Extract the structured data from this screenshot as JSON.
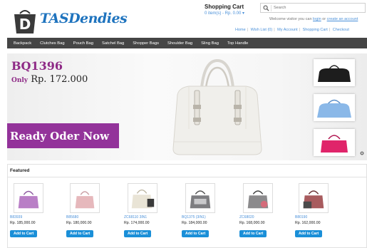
{
  "header": {
    "logo_text": "TASDendies",
    "logo_letter": "D",
    "cart_title": "Shopping Cart",
    "cart_summary": "0 item(s) - Rp. 0.00",
    "search_placeholder": "Search",
    "welcome_prefix": "Welcome visitor you can",
    "login_link": "login",
    "or_text": "or",
    "create_account_link": "create an account",
    "top_links": [
      "Home",
      "Wish List (0)",
      "My Account",
      "Shopping Cart",
      "Checkout"
    ]
  },
  "nav": {
    "items": [
      "Backpack",
      "Clutches Bag",
      "Pouch Bag",
      "Satchel Bag",
      "Shopper Bags",
      "Shoulder Bag",
      "Sling Bag",
      "Top Handle"
    ]
  },
  "banner": {
    "product_code": "BQ1396",
    "only_label": "Only",
    "price": "Rp. 172.000",
    "cta": "Ready Oder Now"
  },
  "featured": {
    "title": "Featured",
    "add_to_cart_label": "Add to Cart",
    "products": [
      {
        "code": "B83939",
        "price": "Rp. 185,000.00",
        "color": "#b97fc6"
      },
      {
        "code": "B85680",
        "price": "Rp. 180,000.00",
        "color": "#e6b8bc"
      },
      {
        "code": "ZC68110 3IN1",
        "price": "Rp. 174,000.00",
        "color": "#e9e4d6"
      },
      {
        "code": "BQ1375 (3IN1)",
        "price": "Rp. 184,000.00",
        "color": "#7d7d80"
      },
      {
        "code": "ZC68020",
        "price": "Rp. 168,000.00",
        "color": "#8b8a8c"
      },
      {
        "code": "B80190",
        "price": "Rp. 162,000.00",
        "color": "#a85b5e"
      }
    ]
  },
  "colors": {
    "brand": "#1e73be",
    "promo_purple": "#93339a",
    "nav_bg": "#454545",
    "button_blue": "#1a8fd8"
  }
}
